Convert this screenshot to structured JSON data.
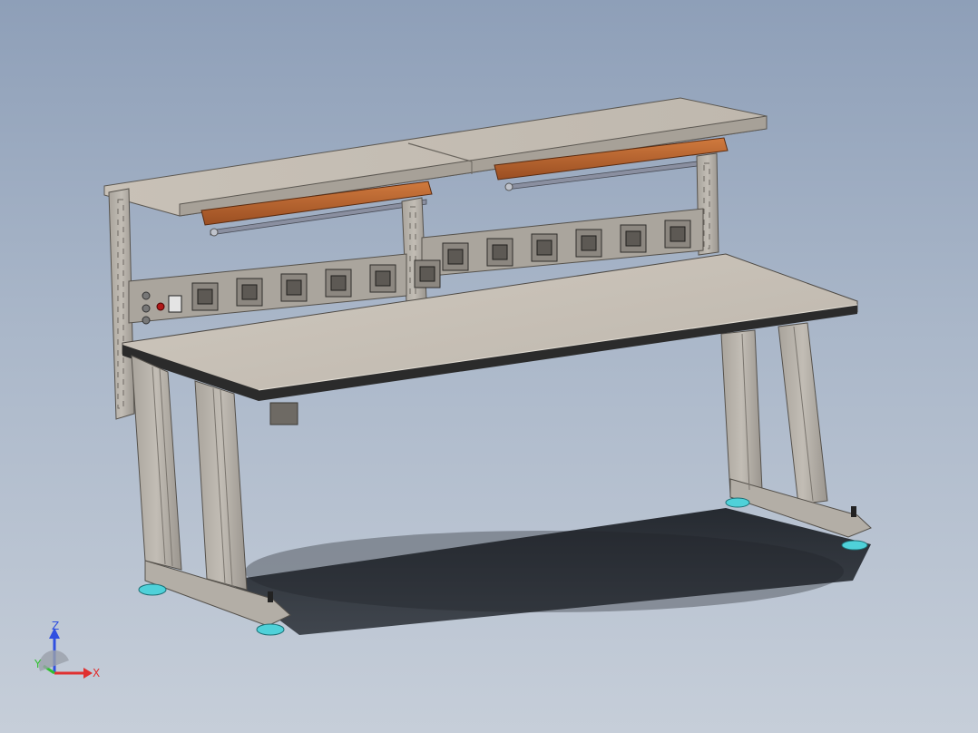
{
  "viewport": {
    "background_top": "#8e9fb8",
    "background_bottom": "#c6ced9"
  },
  "model": {
    "name": "workbench-assembly",
    "outlet_strip_left_count": 6,
    "outlet_strip_right_count": 6,
    "shelf_lamps": 2,
    "leveling_feet": 4
  },
  "colors": {
    "frame": "#b7b2aa",
    "frame_shadow": "#8f8a83",
    "top": "#c9c2b8",
    "edge": "#2a2a2a",
    "lamp": "#b5622e",
    "foot": "#4fd1d9",
    "axis_x": "#e03030",
    "axis_y": "#30c030",
    "axis_z": "#3050e0"
  },
  "triad": {
    "x_label": "X",
    "y_label": "Y",
    "z_label": "Z"
  }
}
